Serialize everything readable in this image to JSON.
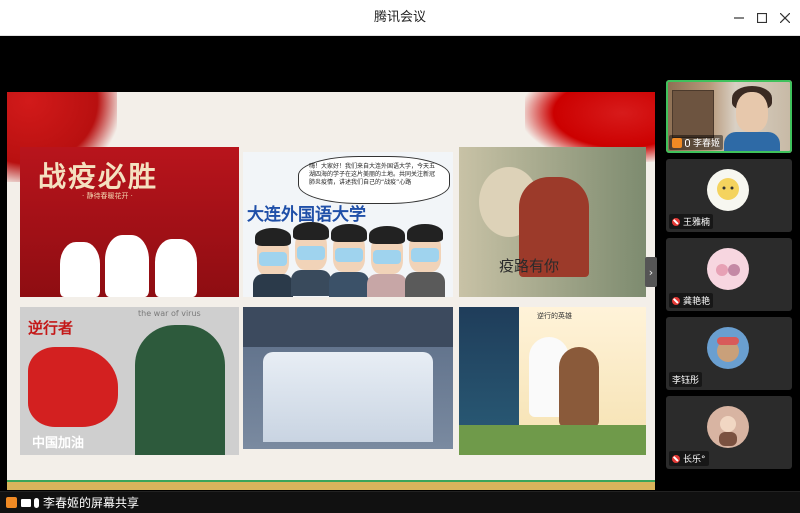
{
  "window": {
    "title": "腾讯会议"
  },
  "posters": {
    "p1": {
      "title": "战疫必胜",
      "subtitle": "· 静待春暖花开 ·"
    },
    "p2": {
      "bubble": "嗨！大家好！我们来自大连外国语大学，今天五湖四海的学子在这片美丽的土地。共同关注新冠肺炎疫情，讲述我们自己的“战疫”心路",
      "university": "大连外国语大学"
    },
    "p3": {
      "caption": "疫路有你"
    },
    "p4": {
      "title": "逆行者",
      "english": "the war of virus",
      "bottom": "中国加油"
    },
    "p6": {
      "title": "逆行的英雄"
    }
  },
  "participants": {
    "active": {
      "name": "李春姬"
    },
    "list": [
      {
        "name": "王雅楠",
        "avatar_color": "#f7f7f0"
      },
      {
        "name": "龚艳艳",
        "avatar_color": "#f7d6e0"
      },
      {
        "name": "李钰彤",
        "avatar_color": "#6a9fd0"
      },
      {
        "name": "长乐°",
        "avatar_color": "#d8b4a2"
      }
    ]
  },
  "status": {
    "share_label": "李春姬的屏幕共享"
  },
  "colors": {
    "accent_green": "#3fc15c",
    "mic_muted": "#e53935",
    "host": "#f08a24"
  }
}
